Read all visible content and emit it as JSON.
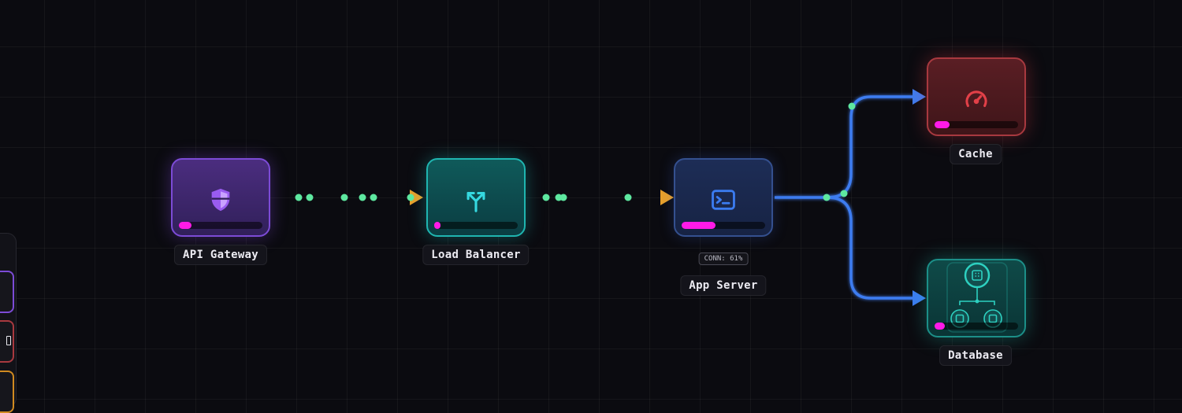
{
  "nodes": {
    "api_gateway": {
      "label": "API Gateway",
      "icon": "shield-icon",
      "load": 0.15,
      "color": "#9a5cf0"
    },
    "load_balancer": {
      "label": "Load Balancer",
      "icon": "split-arrows-icon",
      "load": 0.08,
      "color": "#35d9e0"
    },
    "app_server": {
      "label": "App Server",
      "icon": "terminal-icon",
      "load": 0.41,
      "badge": "CONN: 61%",
      "color": "#3b7cf0"
    },
    "cache": {
      "label": "Cache",
      "icon": "speedometer-icon",
      "load": 0.18,
      "color": "#e24048"
    },
    "database": {
      "label": "Database",
      "icon": "database-cluster-icon",
      "load": 0.12,
      "color": "#2dd0c0"
    }
  },
  "edges": {
    "gateway_to_lb": {
      "color": "#e8a02a"
    },
    "lb_to_app": {
      "color": "#e8a02a"
    },
    "app_to_cache": {
      "color": "#3d7cf0"
    },
    "app_to_db": {
      "color": "#3d7cf0"
    }
  },
  "packet_color": "#5ee8a0",
  "load_bar_color": "#ff1ae8",
  "sidebar": {
    "items": [
      {
        "name": "sidebar-item-purple",
        "color": "#7c4bd6"
      },
      {
        "name": "sidebar-item-red",
        "color": "#a8393f"
      },
      {
        "name": "sidebar-item-orange",
        "color": "#d08a20"
      }
    ]
  }
}
